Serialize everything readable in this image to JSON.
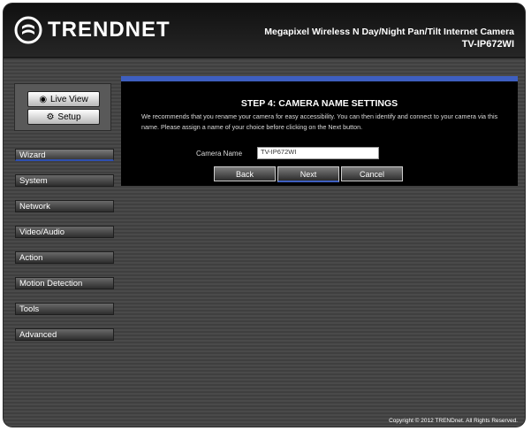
{
  "header": {
    "logo_text": "TRENDNET",
    "product_line1": "Megapixel Wireless N Day/Night Pan/Tilt Internet Camera",
    "product_line2": "TV-IP672WI"
  },
  "mode": {
    "live_label": "Live View",
    "setup_label": "Setup"
  },
  "menu": {
    "items": [
      {
        "label": "Wizard"
      },
      {
        "label": "System"
      },
      {
        "label": "Network"
      },
      {
        "label": "Video/Audio"
      },
      {
        "label": "Action"
      },
      {
        "label": "Motion Detection"
      },
      {
        "label": "Tools"
      },
      {
        "label": "Advanced"
      }
    ],
    "active": "Wizard"
  },
  "wizard": {
    "title": "STEP 4: CAMERA NAME SETTINGS",
    "description": "We recommends that you rename your camera for easy accessibility. You can then identify and connect to your camera via this name. Please assign a name of your choice before clicking on the Next button.",
    "field_label": "Camera Name",
    "field_value": "TV-IP672WI",
    "back_label": "Back",
    "next_label": "Next",
    "cancel_label": "Cancel"
  },
  "footer": {
    "copyright": "Copyright © 2012 TRENDnet. All Rights Reserved."
  },
  "colors": {
    "accent": "#3e5fc0",
    "panel_bg": "#000000",
    "frame_bg": "#444444"
  }
}
